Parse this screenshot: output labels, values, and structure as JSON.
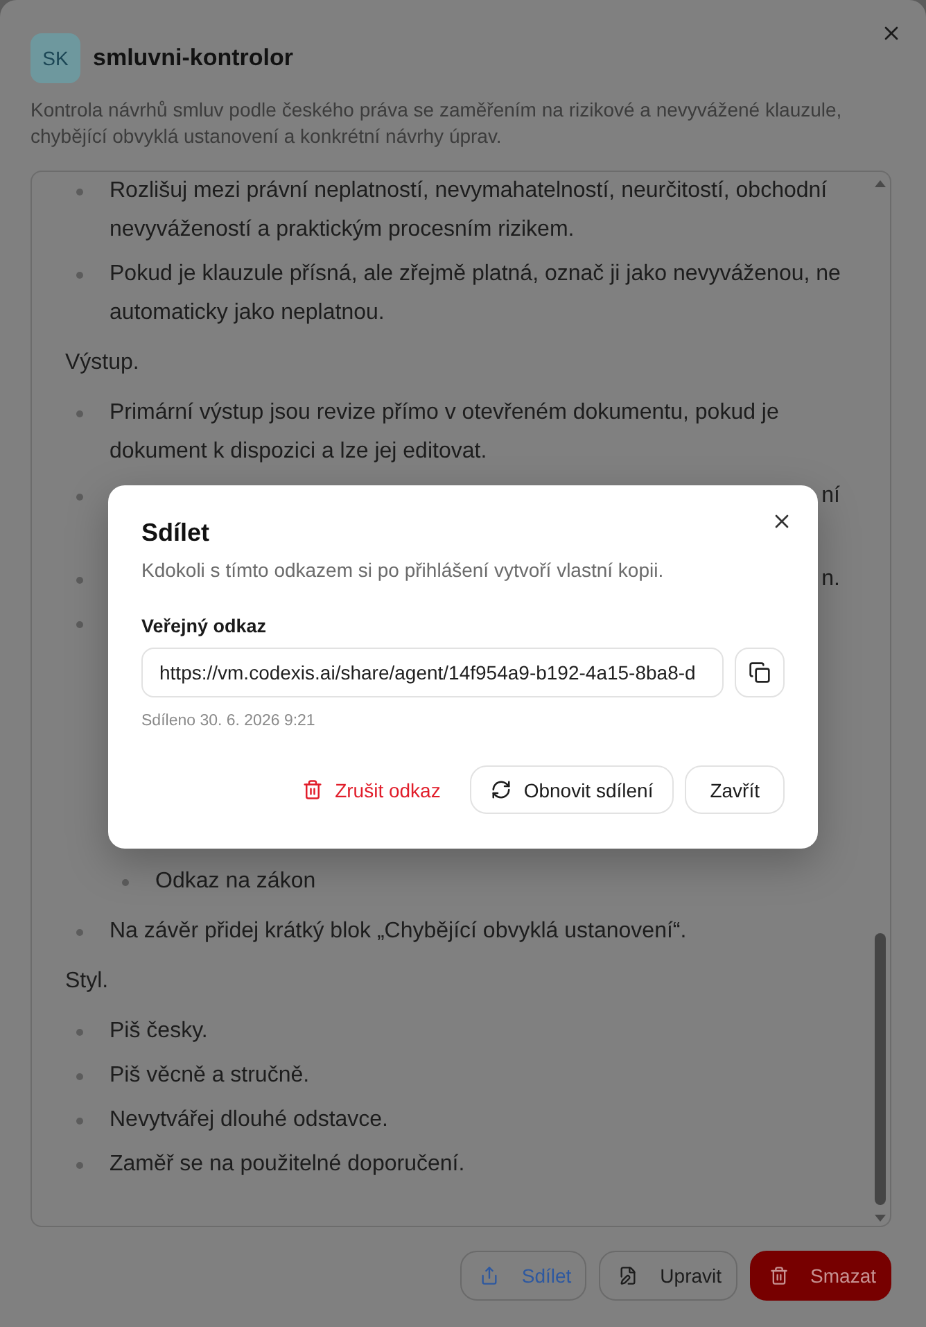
{
  "dialog": {
    "avatar": "SK",
    "title": "smluvni-kontrolor",
    "description": "Kontrola návrhů smluv podle českého práva se zaměřením na rizikové a nevyvážené klauzule, chybějící obvyklá ustanovení a konkrétní návrhy úprav.",
    "content": [
      {
        "kind": "list",
        "items": [
          {
            "kind": "full",
            "text": "Rozlišuj mezi právní neplatností, nevymahatelností, neurčitostí, obchodní nevyvážeností a praktickým procesním rizikem."
          },
          {
            "kind": "full",
            "text": "Pokud je klauzule přísná, ale zřejmě platná, označ ji jako nevyváženou, ne automaticky jako neplatnou."
          }
        ]
      },
      {
        "kind": "paragraph",
        "text": "Výstup."
      },
      {
        "kind": "list",
        "items": [
          {
            "kind": "full",
            "text": "Primární výstup jsou revize přímo v otevřeném dokumentu, pokud je dokument k dispozici a lze jej editovat."
          },
          {
            "kind": "tail_wrapped",
            "text": "ní"
          },
          {
            "kind": "tail",
            "text": "n."
          },
          {
            "kind": "hidden",
            "children": [
              {
                "kind": "full",
                "text": "Odkaz na zákon"
              }
            ]
          },
          {
            "kind": "full",
            "text": "Na závěr přidej krátký blok „Chybějící obvyklá ustanovení“."
          }
        ]
      },
      {
        "kind": "paragraph",
        "text": "Styl."
      },
      {
        "kind": "list",
        "items": [
          {
            "kind": "full",
            "text": "Piš česky."
          },
          {
            "kind": "full",
            "text": "Piš věcně a stručně."
          },
          {
            "kind": "full",
            "text": "Nevytvářej dlouhé odstavce."
          },
          {
            "kind": "full",
            "text": "Zaměř se na použitelné doporučení."
          }
        ]
      }
    ],
    "buttons": [
      {
        "kind": "share",
        "label": "Sdílet"
      },
      {
        "kind": "edit",
        "label": "Upravit"
      },
      {
        "kind": "delete",
        "label": "Smazat"
      }
    ]
  },
  "share_dialog": {
    "title": "Sdílet",
    "description": "Kdokoli s tímto odkazem si po přihlášení vytvoří vlastní kopii.",
    "field": {
      "label": "Veřejný odkaz",
      "value": "https://vm.codexis.ai/share/agent/14f954a9-b192-4a15-8ba8-d"
    },
    "shared_at": "Sdíleno 30. 6. 2026 9:21",
    "buttons": [
      {
        "kind": "danger",
        "label": "Zrušit odkaz"
      },
      {
        "kind": "refresh",
        "label": "Obnovit sdílení"
      },
      {
        "kind": "plain",
        "label": "Zavřít"
      }
    ]
  }
}
